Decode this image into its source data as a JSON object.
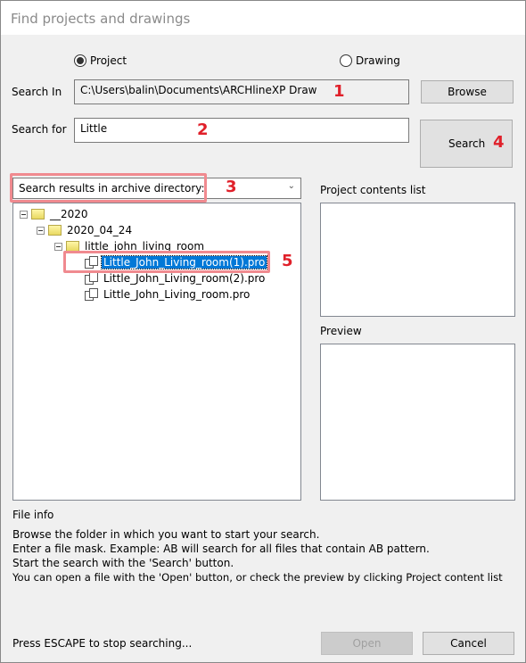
{
  "window": {
    "title": "Find projects and drawings"
  },
  "mode": {
    "project_label": "Project",
    "drawing_label": "Drawing",
    "selected": "Project"
  },
  "search_in": {
    "label": "Search In",
    "value": "C:\\Users\\balin\\Documents\\ARCHlineXP Draw",
    "browse_label": "Browse"
  },
  "search_for": {
    "label": "Search for",
    "value": "Little",
    "search_label": "Search"
  },
  "scope_dropdown": {
    "value": "Search results in archive directory:"
  },
  "tree": [
    {
      "label": "__2020",
      "type": "folder"
    },
    {
      "label": "2020_04_24",
      "type": "folder"
    },
    {
      "label": "little_john_living_room",
      "type": "folder"
    },
    {
      "label": "Little_John_Living_room(1).pro",
      "type": "file",
      "selected": true
    },
    {
      "label": "Little_John_Living_room(2).pro",
      "type": "file"
    },
    {
      "label": "Little_John_Living_room.pro",
      "type": "file"
    }
  ],
  "project_contents": {
    "label": "Project contents list"
  },
  "preview": {
    "label": "Preview"
  },
  "file_info": {
    "label": "File info",
    "lines": [
      "Browse the folder in which you want to start your search.",
      "Enter a file mask. Example: AB will search for all files that contain AB pattern.",
      "Start the search with the 'Search' button.",
      "You can open a file with the 'Open' button, or check the preview by clicking Project content list"
    ]
  },
  "footer": {
    "status": "Press ESCAPE to stop searching...",
    "open_label": "Open",
    "cancel_label": "Cancel"
  },
  "annotations": [
    "1",
    "2",
    "3",
    "4",
    "5"
  ],
  "colors": {
    "annotation": "#e0202a",
    "highlight": "#f08a8f",
    "selection": "#0078d7"
  }
}
